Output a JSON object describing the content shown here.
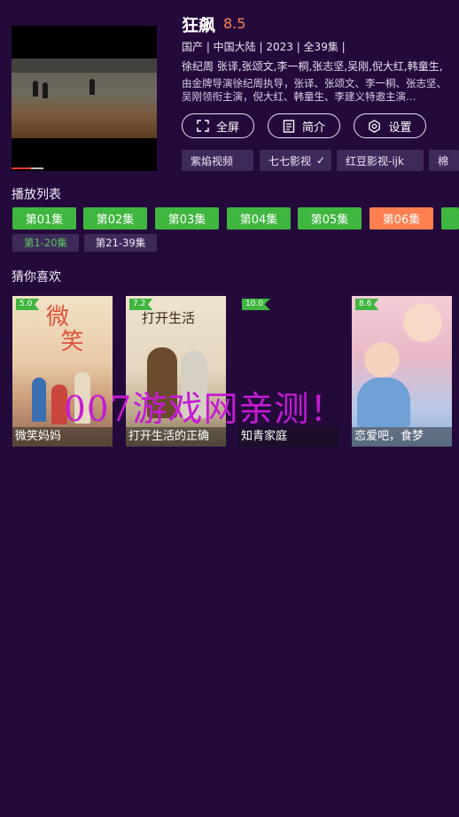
{
  "show": {
    "title": "狂飙",
    "rating": "8.5",
    "meta": "国产 | 中国大陆 | 2023 | 全39集 |",
    "director_cast": "徐纪周   张译,张颂文,李一桐,张志坚,吴刚,倪大红,韩童生,",
    "description": "由金牌导演徐纪周执导，张译、张颂文、李一桐、张志坚、吴刚领衔主演，倪大红、韩童生、李建义特邀主演…"
  },
  "actions": [
    {
      "label": "全屏",
      "icon": "fullscreen-icon"
    },
    {
      "label": "简介",
      "icon": "document-icon"
    },
    {
      "label": "设置",
      "icon": "settings-hexagon-icon"
    }
  ],
  "sources": [
    "紫焰视频",
    "七七影视",
    "红豆影视-ijk",
    "棉"
  ],
  "selected_source_check": "✓",
  "playlist": {
    "label": "播放列表",
    "episodes": [
      "第01集",
      "第02集",
      "第03集",
      "第04集",
      "第05集",
      "第06集"
    ],
    "active_episode": "第06集",
    "ranges": [
      "第1-20集",
      "第21-39集"
    ],
    "active_range": "第1-20集"
  },
  "recommend": {
    "label": "猜你喜欢",
    "items": [
      {
        "title": "微笑妈妈",
        "score": "5.0"
      },
      {
        "title": "打开生活的正确",
        "score": "7.2"
      },
      {
        "title": "知青家庭",
        "score": "10.0"
      },
      {
        "title": "恋爱吧，食梦",
        "score": "8.6"
      }
    ]
  },
  "watermark": "007游戏网亲测！",
  "colors": {
    "background": "#230a3b",
    "episode_green": "#3fb63f",
    "episode_active": "#ff7f50",
    "rating": "#ff7f50",
    "chip_bg": "#3e2a5a",
    "watermark": "#c51bd6"
  }
}
